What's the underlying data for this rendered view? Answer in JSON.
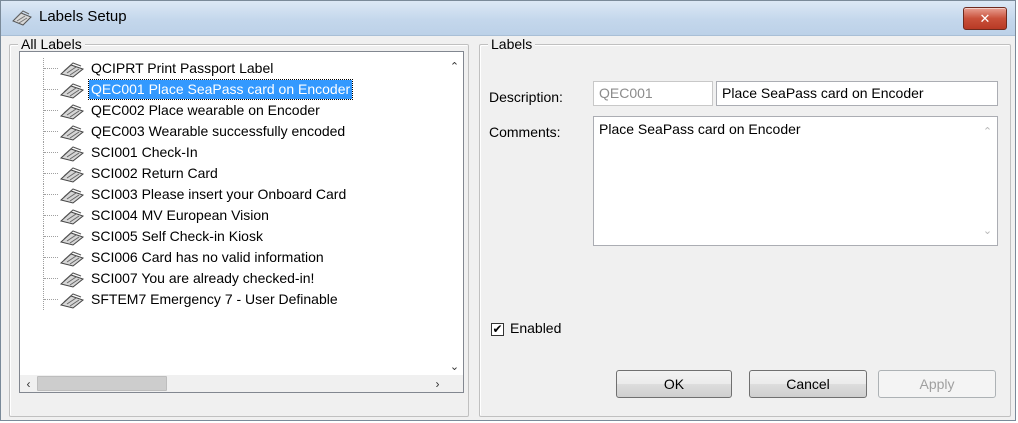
{
  "window": {
    "title": "Labels Setup",
    "close_label": "✕"
  },
  "all_labels": {
    "legend": "All Labels",
    "items": [
      {
        "label": "QCIPRT  Print Passport Label",
        "selected": false
      },
      {
        "label": "QEC001  Place SeaPass card on Encoder",
        "selected": true
      },
      {
        "label": "QEC002  Place wearable on Encoder",
        "selected": false
      },
      {
        "label": "QEC003  Wearable successfully encoded",
        "selected": false
      },
      {
        "label": "SCI001  Check-In",
        "selected": false
      },
      {
        "label": "SCI002  Return Card",
        "selected": false
      },
      {
        "label": "SCI003  Please insert your Onboard Card",
        "selected": false
      },
      {
        "label": "SCI004  MV European Vision",
        "selected": false
      },
      {
        "label": "SCI005  Self Check-in Kiosk",
        "selected": false
      },
      {
        "label": "SCI006  Card has no valid information",
        "selected": false
      },
      {
        "label": "SCI007  You are already checked-in!",
        "selected": false
      },
      {
        "label": "SFTEM7  Emergency 7 - User Definable",
        "selected": false
      }
    ]
  },
  "labels_panel": {
    "legend": "Labels",
    "description_label": "Description:",
    "description_code": "QEC001",
    "description_text": "Place SeaPass card on Encoder",
    "comments_label": "Comments:",
    "comments_text": "Place SeaPass card on Encoder",
    "enabled_label": "Enabled",
    "enabled_checked": true
  },
  "buttons": {
    "ok": "OK",
    "cancel": "Cancel",
    "apply": "Apply"
  },
  "icons": {
    "title": "label-printer-icon",
    "row": "label-printer-icon"
  }
}
